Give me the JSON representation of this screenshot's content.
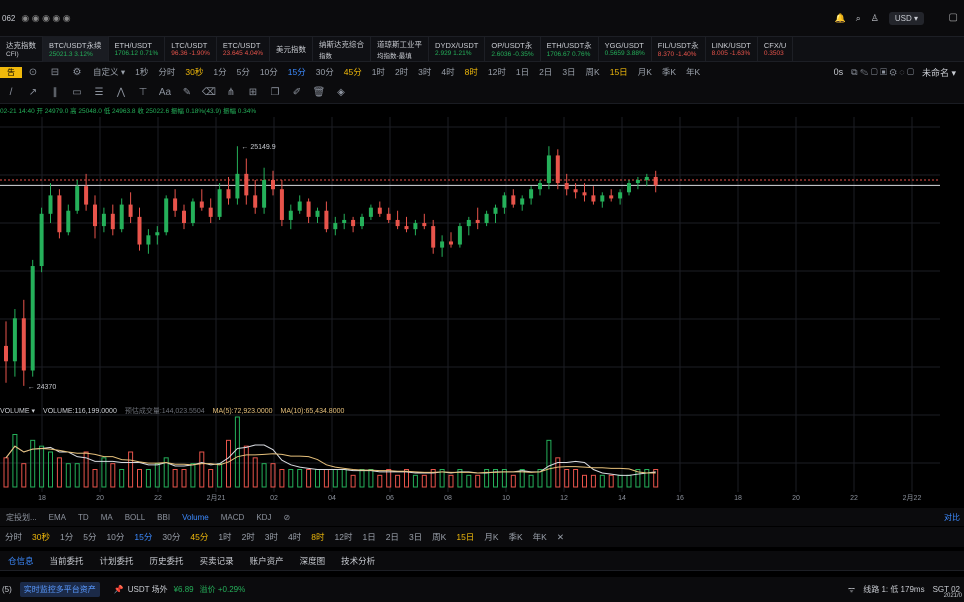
{
  "topbar": {
    "left_number": "062",
    "currency": "USD ▾"
  },
  "ticker": [
    {
      "name": "达克指数",
      "sub": "CFI)",
      "pct": "",
      "dir": "none"
    },
    {
      "name": "BTC/USDT永续",
      "sub": "25021.3  3.12%",
      "dir": "up",
      "active": true
    },
    {
      "name": "ETH/USDT",
      "sub": "1706.12  0.71%",
      "dir": "up"
    },
    {
      "name": "LTC/USDT",
      "sub": "96.36  -1.90%",
      "dir": "dn"
    },
    {
      "name": "ETC/USDT",
      "sub": "23.645  4.04%",
      "dir": "dn"
    },
    {
      "name": "美元指数",
      "sub": "",
      "dir": "none"
    },
    {
      "name": "纳斯达克综合",
      "sub": "指数",
      "dir": "none"
    },
    {
      "name": "道琼斯工业平",
      "sub": "均指数-最填",
      "dir": "none"
    },
    {
      "name": "DYDX/USDT",
      "sub": "2.929  1.21%",
      "dir": "up"
    },
    {
      "name": "OP/USDT永",
      "sub": "2.6036  -0.35%",
      "dir": "up"
    },
    {
      "name": "ETH/USDT永",
      "sub": "1706.67  0.76%",
      "dir": "up"
    },
    {
      "name": "YGG/USDT",
      "sub": "0.5659  3.88%",
      "dir": "up"
    },
    {
      "name": "FIL/USDT永",
      "sub": "8.370  -1.40%",
      "dir": "dn"
    },
    {
      "name": "LINK/USDT",
      "sub": "8.005  -1.63%",
      "dir": "dn"
    },
    {
      "name": "CFX/U",
      "sub": "0.3503",
      "dir": "dn"
    }
  ],
  "timeframes": [
    "自定义 ▾",
    "1秒",
    "分时",
    "30秒",
    "1分",
    "5分",
    "10分",
    "15分",
    "30分",
    "45分",
    "1时",
    "2时",
    "3时",
    "4时",
    "8时",
    "12时",
    "1日",
    "2日",
    "3日",
    "周K",
    "15日",
    "月K",
    "季K",
    "年K"
  ],
  "timeframe_active": "15分",
  "timeframe_highlight": [
    "30秒",
    "45分",
    "8时",
    "15日"
  ],
  "top_right_tools": [
    "0s",
    "未命名 ▾"
  ],
  "ohlc_line": "02-21 14:40  开 24979.0  高 25048.0  低 24963.8  收 25022.6  振幅 0.18%(43.9)  振幅 0.34%",
  "price_labels": {
    "high": "25149.9",
    "low": "24370"
  },
  "volume": {
    "label": "VOLUME ▾",
    "value": "VOLUME:116,199.0000",
    "ma_grey": "预估成交量:144,023.5504",
    "ma5": "MA(5):72,923.0000",
    "ma10": "MA(10):65,434.8000"
  },
  "x_axis": [
    "18",
    "20",
    "22",
    "2月21",
    "02",
    "04",
    "06",
    "08",
    "10",
    "12",
    "14",
    "16",
    "18",
    "20",
    "22",
    "2月22"
  ],
  "indicators": [
    "定投划...",
    "EMA",
    "TD",
    "MA",
    "BOLL",
    "BBI",
    "Volume",
    "MACD",
    "KDJ",
    "⊘"
  ],
  "indicator_active": "Volume",
  "indicator_right": "对比",
  "timeframes2": [
    "分时",
    "30秒",
    "1分",
    "5分",
    "10分",
    "15分",
    "30分",
    "45分",
    "1时",
    "2时",
    "3时",
    "4时",
    "8时",
    "12时",
    "1日",
    "2日",
    "3日",
    "周K",
    "15日",
    "月K",
    "季K",
    "年K",
    "✕"
  ],
  "timeframe2_active": "15分",
  "bottom_tabs": [
    "仓信息",
    "当前委托",
    "计划委托",
    "历史委托",
    "买卖记录",
    "账户资产",
    "深度图",
    "技术分析"
  ],
  "bottom_tab_active": "仓信息",
  "status": {
    "left": "(5)",
    "badge": "实时监控多平台资产",
    "usdt_label": "USDT 场外",
    "usdt_price": "¥6.89",
    "premium": "溢价 +0.29%",
    "line": "线路 1: 低 179ms",
    "tz": "SGT 02",
    "date": "2021/0"
  },
  "chart_data": {
    "type": "candlestick",
    "note_levels": {
      "high_label": 25149.9,
      "low_label": 24370
    },
    "candles": [
      [
        24500,
        24580,
        24380,
        24450
      ],
      [
        24450,
        24620,
        24400,
        24590
      ],
      [
        24590,
        24650,
        24370,
        24420
      ],
      [
        24420,
        24780,
        24400,
        24760
      ],
      [
        24760,
        24950,
        24740,
        24930
      ],
      [
        24930,
        25030,
        24900,
        24990
      ],
      [
        24990,
        25010,
        24850,
        24870
      ],
      [
        24870,
        24960,
        24860,
        24940
      ],
      [
        24940,
        25040,
        24930,
        25020
      ],
      [
        25020,
        25060,
        24940,
        24960
      ],
      [
        24960,
        24990,
        24850,
        24890
      ],
      [
        24890,
        24950,
        24870,
        24930
      ],
      [
        24930,
        24960,
        24860,
        24880
      ],
      [
        24880,
        24980,
        24870,
        24960
      ],
      [
        24960,
        25000,
        24900,
        24920
      ],
      [
        24920,
        24950,
        24810,
        24830
      ],
      [
        24830,
        24880,
        24800,
        24860
      ],
      [
        24860,
        24890,
        24830,
        24870
      ],
      [
        24870,
        24990,
        24860,
        24980
      ],
      [
        24980,
        25010,
        24920,
        24940
      ],
      [
        24940,
        24960,
        24880,
        24900
      ],
      [
        24900,
        24980,
        24890,
        24970
      ],
      [
        24970,
        25010,
        24940,
        24950
      ],
      [
        24950,
        24980,
        24900,
        24920
      ],
      [
        24920,
        25030,
        24910,
        25010
      ],
      [
        25010,
        25050,
        24960,
        24980
      ],
      [
        24980,
        25150,
        24960,
        25060
      ],
      [
        25060,
        25110,
        24960,
        24990
      ],
      [
        24990,
        25040,
        24930,
        24950
      ],
      [
        24950,
        25080,
        24930,
        25040
      ],
      [
        25040,
        25070,
        24990,
        25010
      ],
      [
        25010,
        25040,
        24890,
        24910
      ],
      [
        24910,
        24960,
        24880,
        24940
      ],
      [
        24940,
        24990,
        24930,
        24970
      ],
      [
        24970,
        24980,
        24900,
        24920
      ],
      [
        24920,
        24950,
        24900,
        24940
      ],
      [
        24940,
        24970,
        24870,
        24880
      ],
      [
        24880,
        24920,
        24860,
        24900
      ],
      [
        24900,
        24930,
        24880,
        24910
      ],
      [
        24910,
        24920,
        24870,
        24890
      ],
      [
        24890,
        24930,
        24880,
        24920
      ],
      [
        24920,
        24960,
        24910,
        24950
      ],
      [
        24950,
        24970,
        24920,
        24930
      ],
      [
        24930,
        24950,
        24900,
        24910
      ],
      [
        24910,
        24940,
        24880,
        24890
      ],
      [
        24890,
        24920,
        24870,
        24880
      ],
      [
        24880,
        24910,
        24860,
        24900
      ],
      [
        24900,
        24930,
        24880,
        24890
      ],
      [
        24890,
        24910,
        24800,
        24820
      ],
      [
        24820,
        24860,
        24790,
        24840
      ],
      [
        24840,
        24870,
        24820,
        24830
      ],
      [
        24830,
        24900,
        24820,
        24890
      ],
      [
        24890,
        24920,
        24860,
        24910
      ],
      [
        24910,
        24950,
        24880,
        24900
      ],
      [
        24900,
        24940,
        24890,
        24930
      ],
      [
        24930,
        24960,
        24900,
        24950
      ],
      [
        24950,
        25000,
        24930,
        24990
      ],
      [
        24990,
        25010,
        24950,
        24960
      ],
      [
        24960,
        24990,
        24940,
        24980
      ],
      [
        24980,
        25020,
        24960,
        25010
      ],
      [
        25010,
        25040,
        24990,
        25030
      ],
      [
        25030,
        25150,
        25010,
        25120
      ],
      [
        25120,
        25140,
        25010,
        25030
      ],
      [
        25030,
        25060,
        24990,
        25010
      ],
      [
        25010,
        25030,
        24980,
        25000
      ],
      [
        25000,
        25030,
        24970,
        24990
      ],
      [
        24990,
        25020,
        24960,
        24970
      ],
      [
        24970,
        25000,
        24950,
        24990
      ],
      [
        24990,
        25010,
        24970,
        24980
      ],
      [
        24980,
        25010,
        24960,
        25000
      ],
      [
        25000,
        25040,
        24990,
        25030
      ],
      [
        25030,
        25050,
        25010,
        25040
      ],
      [
        25040,
        25060,
        25020,
        25050
      ],
      [
        25050,
        25070,
        25000,
        25022.6
      ]
    ],
    "volumes": [
      5,
      9,
      4,
      8,
      7,
      6,
      5,
      4,
      4,
      6,
      3,
      5,
      4,
      3,
      6,
      3,
      3,
      4,
      5,
      3,
      3,
      4,
      6,
      3,
      4,
      8,
      12,
      7,
      5,
      4,
      4,
      3,
      3,
      3,
      3,
      3,
      3,
      3,
      3,
      2,
      3,
      3,
      2,
      3,
      2,
      3,
      2,
      2,
      3,
      3,
      2,
      3,
      2,
      2,
      3,
      3,
      3,
      2,
      3,
      2,
      3,
      8,
      5,
      3,
      3,
      2,
      2,
      2,
      2,
      2,
      2,
      3,
      3,
      3
    ],
    "xlabels": [
      "18",
      "20",
      "22",
      "2月21",
      "02",
      "04",
      "06",
      "08",
      "10",
      "12",
      "14",
      "16",
      "18",
      "20",
      "22",
      "2月22"
    ]
  }
}
